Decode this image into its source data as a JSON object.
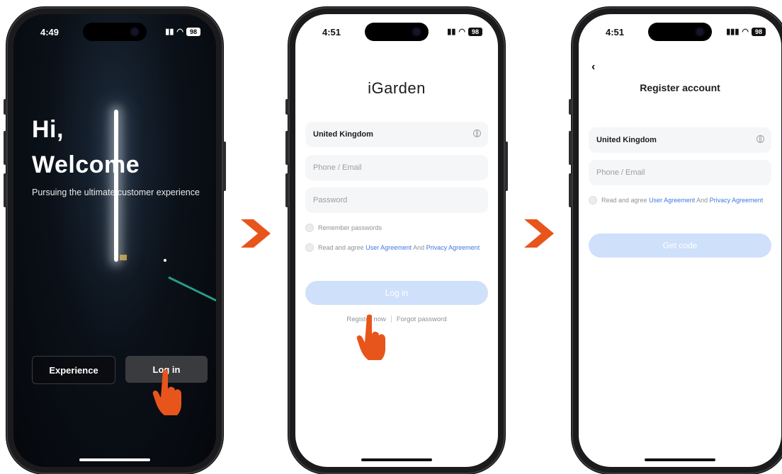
{
  "colors": {
    "accent_orange": "#e8551c",
    "link_blue": "#3f78e0",
    "primary_disabled": "#cfe0fb"
  },
  "phone1": {
    "status": {
      "time": "4:49",
      "battery": "98"
    },
    "greeting_line1": "Hi,",
    "greeting_line2": "Welcome",
    "subtitle": "Pursuing the ultimate customer experience",
    "experience_button": "Experience",
    "login_button": "Log in"
  },
  "phone2": {
    "status": {
      "time": "4:51",
      "battery": "98"
    },
    "app_title": "iGarden",
    "country_value": "United Kingdom",
    "phone_email_placeholder": "Phone / Email",
    "password_placeholder": "Password",
    "remember_label": "Remember passwords",
    "agree_prefix": "Read and agree",
    "user_agreement": "User Agreement",
    "agree_and": "And",
    "privacy_agreement": "Privacy Agreement",
    "login_button": "Log in",
    "register_link": "Register now",
    "forgot_link": "Forgot password"
  },
  "phone3": {
    "status": {
      "time": "4:51",
      "battery": "98"
    },
    "back_icon": "chevron-left-icon",
    "page_title": "Register account",
    "country_value": "United Kingdom",
    "phone_email_placeholder": "Phone / Email",
    "agree_prefix": "Read and agree",
    "user_agreement": "User Agreement",
    "agree_and": "And",
    "privacy_agreement": "Privacy Agreement",
    "get_code_button": "Get code"
  }
}
